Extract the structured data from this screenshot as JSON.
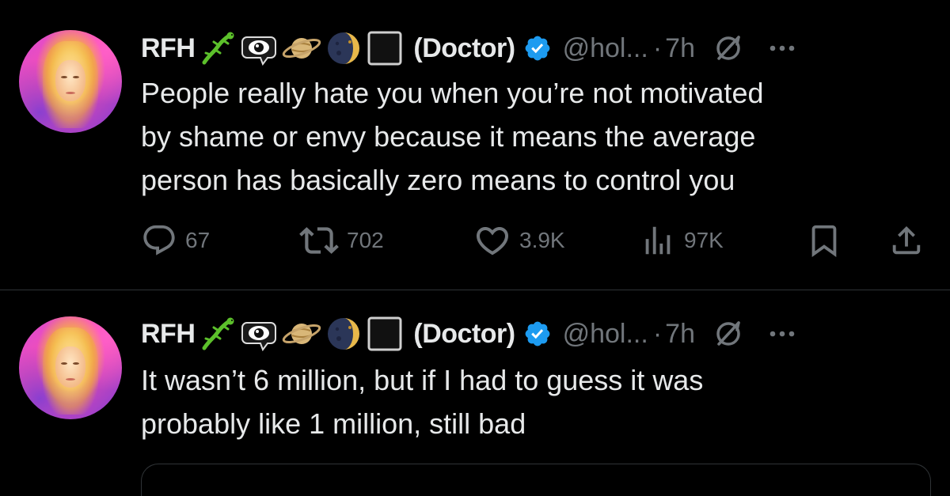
{
  "tweets": [
    {
      "author": {
        "name": "RFH",
        "suffix": "(Doctor)",
        "handle": "@hol...",
        "time": "7h",
        "separator": "·"
      },
      "text_lines": [
        "People really hate you when you’re not motivated",
        "by shame or envy because it means the average",
        "person has basically zero means to control you"
      ],
      "actions": {
        "replies": "67",
        "reposts": "702",
        "likes": "3.9K",
        "views": "97K"
      }
    },
    {
      "author": {
        "name": "RFH",
        "suffix": "(Doctor)",
        "handle": "@hol...",
        "time": "7h",
        "separator": "·"
      },
      "text_lines": [
        "It wasn’t 6 million, but if I had to guess it was",
        "probably like 1 million, still bad"
      ]
    }
  ],
  "name_emojis": [
    "lizard-emoji",
    "eye-in-speech-bubble-emoji",
    "ringed-planet-emoji",
    "new-moon-with-face-emoji",
    "black-square-emoji"
  ],
  "icons": {
    "verified": "verified-badge-icon",
    "grok": "grok-icon",
    "more": "more-options-icon",
    "reply": "reply-icon",
    "repost": "repost-icon",
    "like": "like-icon",
    "views": "views-icon",
    "bookmark": "bookmark-icon",
    "share": "share-icon"
  },
  "colors": {
    "background": "#000000",
    "text": "#e7e9ea",
    "muted": "#71767b",
    "verified_blue": "#1d9bf0",
    "divider": "#2f3336"
  }
}
